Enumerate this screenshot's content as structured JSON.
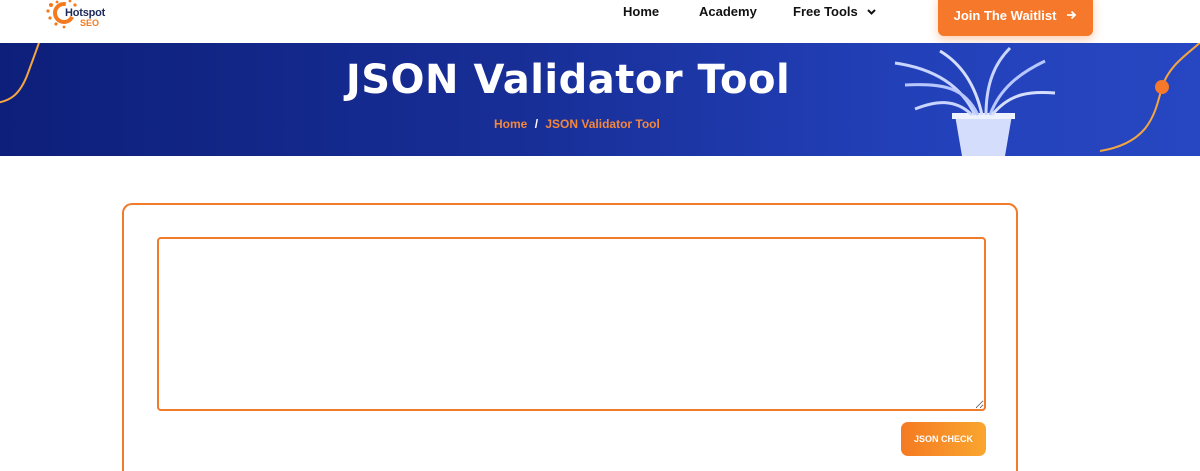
{
  "header": {
    "logo": {
      "line1": "Hotspot",
      "line2": "SEO"
    },
    "nav": {
      "home": "Home",
      "academy": "Academy",
      "free_tools": "Free Tools"
    },
    "cta": {
      "label": "Join The Waitlist",
      "icon": "arrow-right-icon"
    }
  },
  "banner": {
    "title": "JSON Validator Tool",
    "breadcrumb": {
      "home": "Home",
      "separator": "/",
      "current": "JSON Validator Tool"
    }
  },
  "main": {
    "input": {
      "value": "",
      "placeholder": ""
    },
    "check_button": "JSON CHECK"
  },
  "colors": {
    "accent": "#f6782a",
    "banner_start": "#0d1f7a",
    "banner_end": "#2747c2",
    "nav_text": "#111111"
  }
}
